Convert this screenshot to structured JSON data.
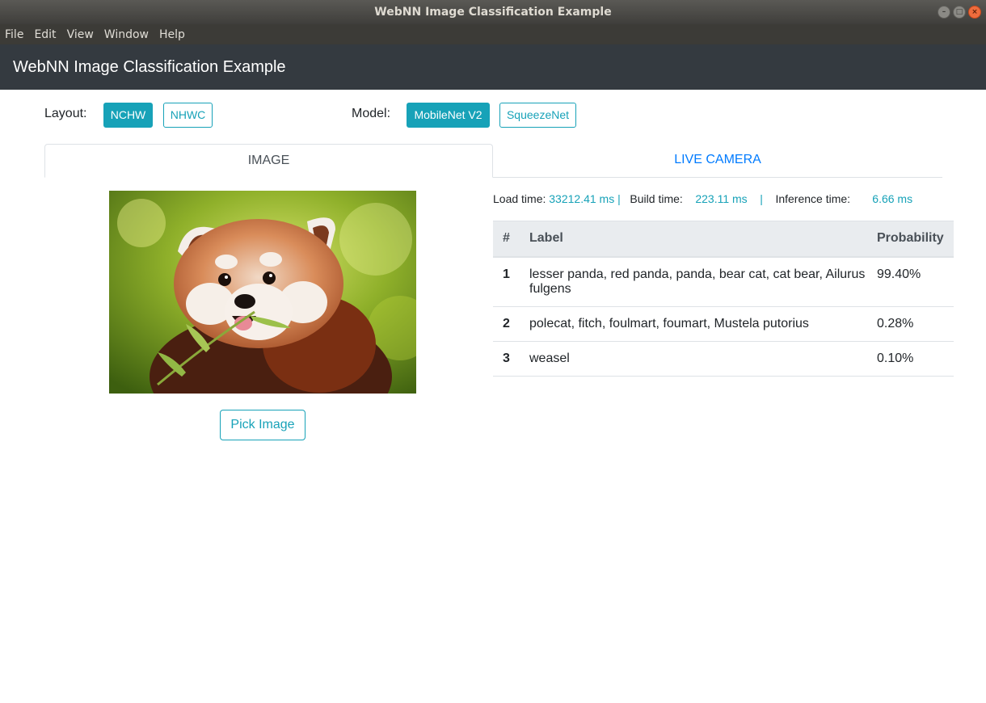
{
  "window": {
    "title": "WebNN Image Classification Example",
    "controls": [
      "–",
      "□",
      "×"
    ]
  },
  "menu": [
    "File",
    "Edit",
    "View",
    "Window",
    "Help"
  ],
  "header": {
    "title": "WebNN Image Classification Example"
  },
  "layout": {
    "label": "Layout:",
    "options": [
      "NCHW",
      "NHWC"
    ],
    "selected": "NCHW"
  },
  "model": {
    "label": "Model:",
    "options": [
      "MobileNet V2",
      "SqueezeNet"
    ],
    "selected": "MobileNet V2"
  },
  "tabs": [
    {
      "label": "IMAGE",
      "active": true
    },
    {
      "label": "LIVE CAMERA",
      "active": false
    }
  ],
  "image": {
    "pick_label": "Pick Image"
  },
  "timing": {
    "load_label": "Load time:",
    "load_value": "33212.41 ms |",
    "build_label": "Build time:",
    "build_value": "223.11 ms",
    "separator": "|",
    "inference_label": "Inference time:",
    "inference_value": "6.66 ms"
  },
  "results": {
    "headers": [
      "#",
      "Label",
      "Probability"
    ],
    "rows": [
      {
        "rank": "1",
        "label": "lesser panda, red panda, panda, bear cat, cat bear, Ailurus fulgens",
        "probability": "99.40%"
      },
      {
        "rank": "2",
        "label": "polecat, fitch, foulmart, foumart, Mustela putorius",
        "probability": "0.28%"
      },
      {
        "rank": "3",
        "label": "weasel",
        "probability": "0.10%"
      }
    ]
  },
  "colors": {
    "accent": "#17a2b8",
    "link": "#007bff",
    "header_bg": "#343a40"
  }
}
